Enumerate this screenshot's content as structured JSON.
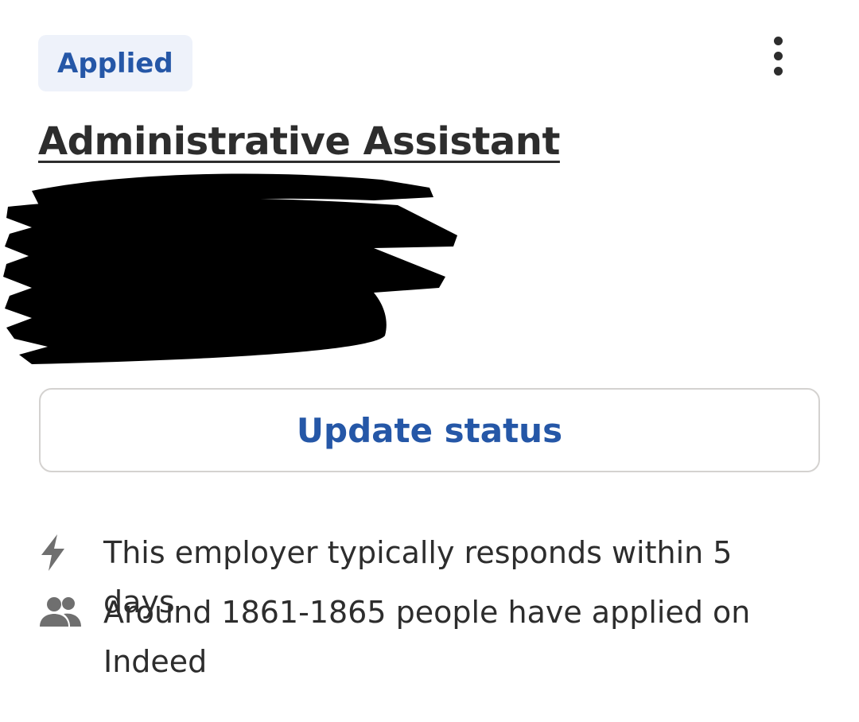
{
  "status": {
    "label": "Applied",
    "color": "#2557a7",
    "background": "#eef2fa"
  },
  "menu": {
    "icon": "more-vertical-icon"
  },
  "job": {
    "title": "Administrative Assistant",
    "company_redacted": true
  },
  "actions": {
    "update_status_label": "Update status"
  },
  "insights": {
    "response_icon": "lightning-bolt-icon",
    "response_text": "This employer typically responds within 5 days",
    "applicants_icon": "people-icon",
    "applicants_text": "Around 1861-1865 people have applied on Indeed"
  }
}
